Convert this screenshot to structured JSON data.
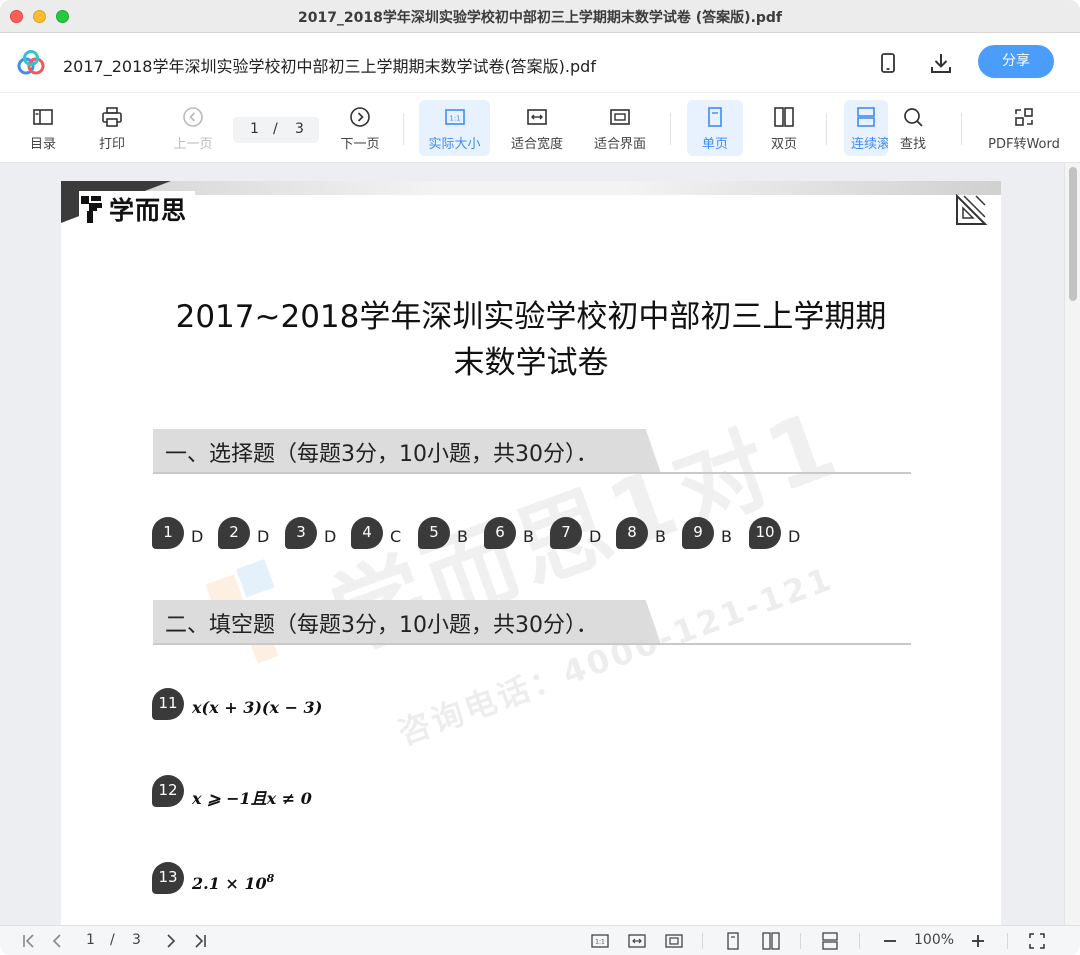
{
  "window": {
    "title": "2017_2018学年深圳实验学校初中部初三上学期期末数学试卷 (答案版).pdf"
  },
  "header": {
    "doc_title": "2017_2018学年深圳实验学校初中部初三上学期期末数学试卷(答案版).pdf",
    "share_label": "分享"
  },
  "toolbar": {
    "toc": "目录",
    "print": "打印",
    "prev": "上一页",
    "current_page": "1",
    "page_sep": "/",
    "total_pages": "3",
    "next": "下一页",
    "actual_size": "实际大小",
    "fit_width": "适合宽度",
    "fit_page": "适合界面",
    "single": "单页",
    "double": "双页",
    "continuous": "连续滚",
    "search": "查找",
    "pdf_to_word": "PDF转Word"
  },
  "page": {
    "brand": "学而思",
    "title_line1": "2017~2018学年深圳实验学校初中部初三上学期期",
    "title_line2": "末数学试卷",
    "section1": "一、选择题（每题3分，10小题，共30分）．",
    "section2": "二、填空题（每题3分，10小题，共30分）．",
    "choice_answers": [
      {
        "num": "1",
        "ans": "D"
      },
      {
        "num": "2",
        "ans": "D"
      },
      {
        "num": "3",
        "ans": "D"
      },
      {
        "num": "4",
        "ans": "C"
      },
      {
        "num": "5",
        "ans": "B"
      },
      {
        "num": "6",
        "ans": "B"
      },
      {
        "num": "7",
        "ans": "D"
      },
      {
        "num": "8",
        "ans": "B"
      },
      {
        "num": "9",
        "ans": "B"
      },
      {
        "num": "10",
        "ans": "D"
      }
    ],
    "fill_answers": [
      {
        "num": "11",
        "ans": "x(x + 3)(x − 3)"
      },
      {
        "num": "12",
        "ans": "x ⩾ −1且x ≠ 0"
      },
      {
        "num": "13",
        "ans_base": "2.1 × 10",
        "ans_exp": "8"
      }
    ],
    "watermark_text": "学而思1对1",
    "watermark_phone": "咨询电话：4000-121-121"
  },
  "statusbar": {
    "current_page": "1",
    "page_sep": "/",
    "total_pages": "3",
    "zoom": "100%"
  },
  "colors": {
    "accent": "#4a9dfb",
    "active_bg": "#e8f1fe",
    "badge": "#3a3a3a"
  }
}
